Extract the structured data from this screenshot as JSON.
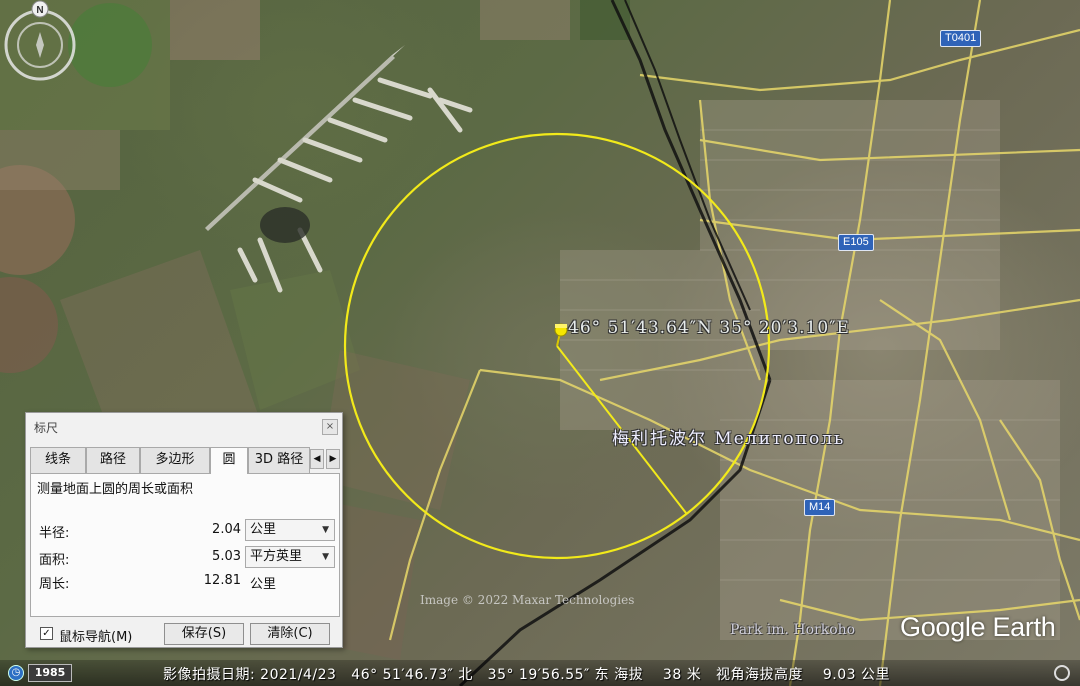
{
  "map": {
    "placemark_coordinate": "46° 51′43.64″N   35° 20′3.10″E",
    "city_name": "梅利托波尔 Мелитополь",
    "park_name": "Park im. Horkoho",
    "imagery_credit": "Image © 2022 Maxar Technologies",
    "logo": "Google Earth",
    "road_badges": [
      "T0401",
      "E105",
      "M14"
    ]
  },
  "ruler": {
    "title": "标尺",
    "tabs": [
      "线条",
      "路径",
      "多边形",
      "圆",
      "3D 路径"
    ],
    "active_tab": "圆",
    "description": "测量地面上圆的周长或面积",
    "radius_label": "半径:",
    "radius_value": "2.04",
    "radius_unit": "公里",
    "area_label": "面积:",
    "area_value": "5.03",
    "area_unit": "平方英里",
    "perimeter_label": "周长:",
    "perimeter_value": "12.81",
    "perimeter_unit": "公里",
    "mouse_nav_label": "鼠标导航(M)",
    "mouse_nav_checked": "✓",
    "save_label": "保存(S)",
    "clear_label": "清除(C)",
    "close_glyph": "×"
  },
  "status": {
    "historical_year": "1985",
    "text": "影像拍摄日期: 2021/4/23   46° 51′46.73″ 北   35° 19′56.55″ 东 海拔    38 米   视角海拔高度    9.03 公里"
  },
  "compass": {
    "north_label": "N"
  }
}
